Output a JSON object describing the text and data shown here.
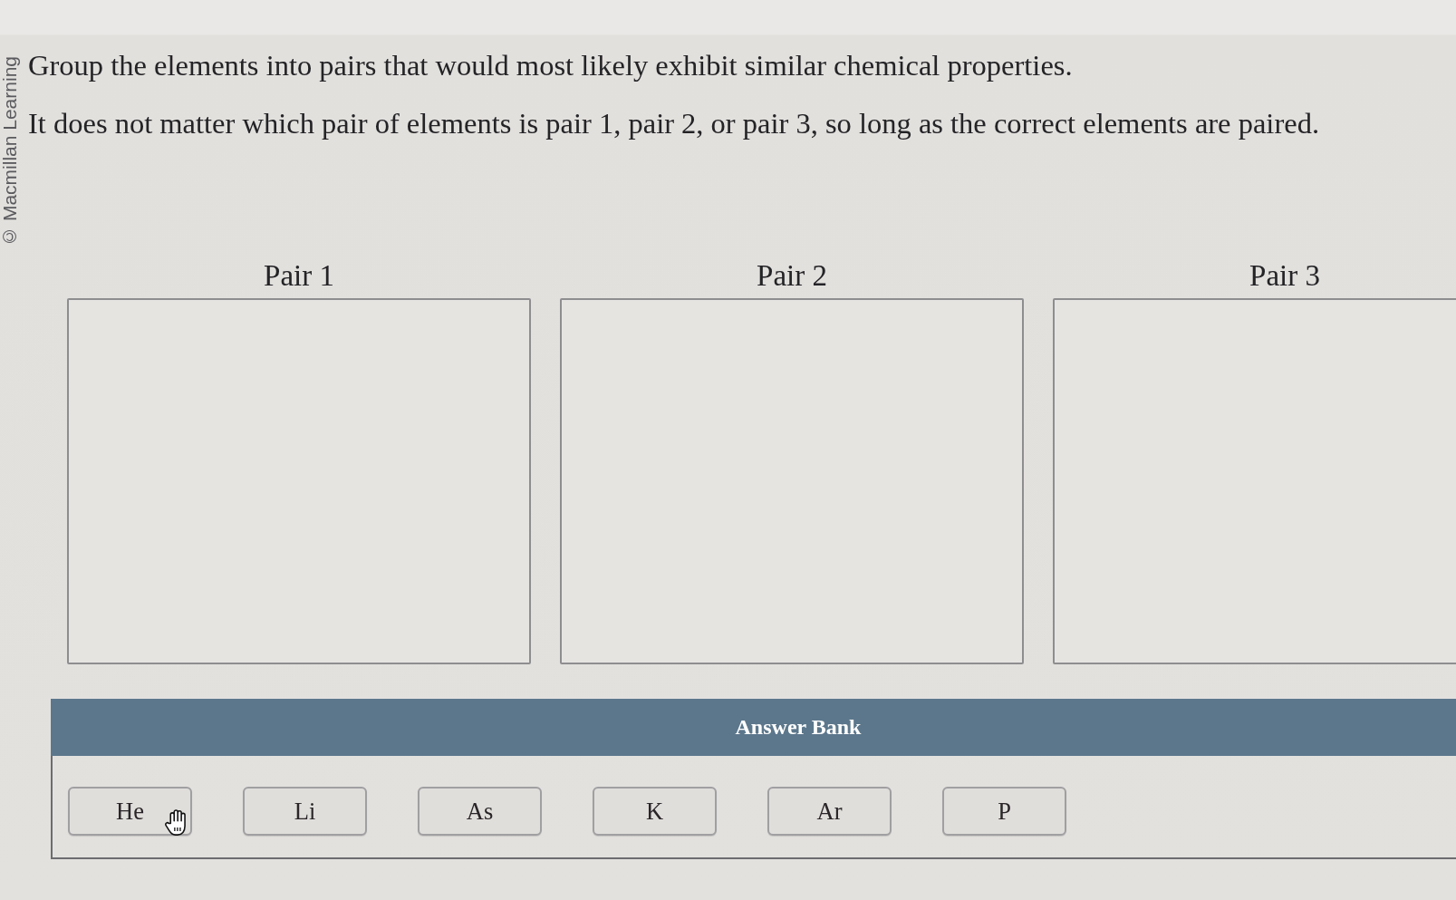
{
  "copyright": "© Macmillan Learning",
  "instructions": [
    "Group the elements into pairs that would most likely exhibit similar chemical properties.",
    "It does not matter which pair of elements is pair 1, pair 2, or pair 3, so long as the correct elements are paired."
  ],
  "pairs": [
    {
      "label": "Pair 1"
    },
    {
      "label": "Pair 2"
    },
    {
      "label": "Pair 3"
    }
  ],
  "answer_bank": {
    "title": "Answer Bank",
    "items": [
      {
        "label": "He",
        "hovered": true
      },
      {
        "label": "Li",
        "hovered": false
      },
      {
        "label": "As",
        "hovered": false
      },
      {
        "label": "K",
        "hovered": false
      },
      {
        "label": "Ar",
        "hovered": false
      },
      {
        "label": "P",
        "hovered": false
      }
    ]
  }
}
